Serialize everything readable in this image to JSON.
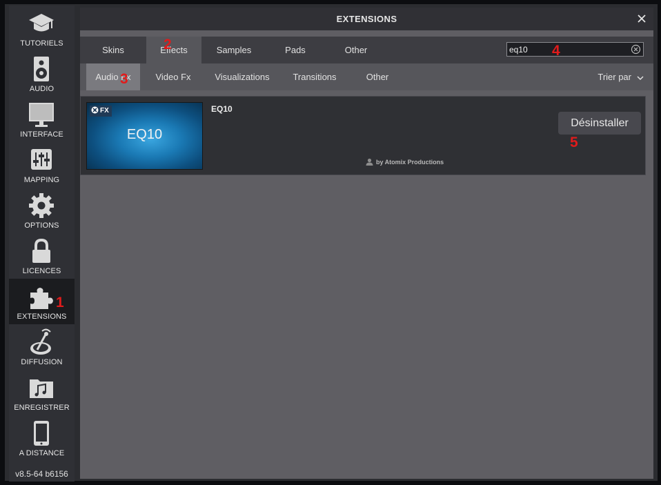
{
  "sidebar": {
    "items": [
      {
        "label": "TUTORIELS",
        "icon": "graduation-cap-icon"
      },
      {
        "label": "AUDIO",
        "icon": "speaker-icon"
      },
      {
        "label": "INTERFACE",
        "icon": "monitor-icon"
      },
      {
        "label": "MAPPING",
        "icon": "sliders-icon"
      },
      {
        "label": "OPTIONS",
        "icon": "gear-icon"
      },
      {
        "label": "LICENCES",
        "icon": "lock-icon"
      },
      {
        "label": "EXTENSIONS",
        "icon": "puzzle-icon",
        "active": true
      },
      {
        "label": "DIFFUSION",
        "icon": "broadcast-icon"
      },
      {
        "label": "ENREGISTRER",
        "icon": "music-folder-icon"
      },
      {
        "label": "A DISTANCE",
        "icon": "tablet-icon"
      }
    ],
    "version": "v8.5-64 b6156"
  },
  "header": {
    "title": "EXTENSIONS",
    "close_icon": "close-icon"
  },
  "tabs": [
    "Skins",
    "Effects",
    "Samples",
    "Pads",
    "Other"
  ],
  "active_tab": "Effects",
  "search": {
    "value": "eq10",
    "clear_icon": "clear-circle-icon"
  },
  "subtabs": [
    "Audio Fx",
    "Video Fx",
    "Visualizations",
    "Transitions",
    "Other"
  ],
  "active_subtab": "Audio Fx",
  "sort_label": "Trier par",
  "results": [
    {
      "name": "EQ10",
      "thumb_badge": "FX",
      "thumb_label": "EQ10",
      "author": "by Atomix Productions",
      "action_label": "Désinstaller"
    }
  ],
  "markers": [
    "1",
    "2",
    "3",
    "4",
    "5"
  ],
  "colors": {
    "accent_marker": "#e01b1b",
    "panel_bg": "#5f5e63",
    "card_bg": "#2f3034"
  }
}
